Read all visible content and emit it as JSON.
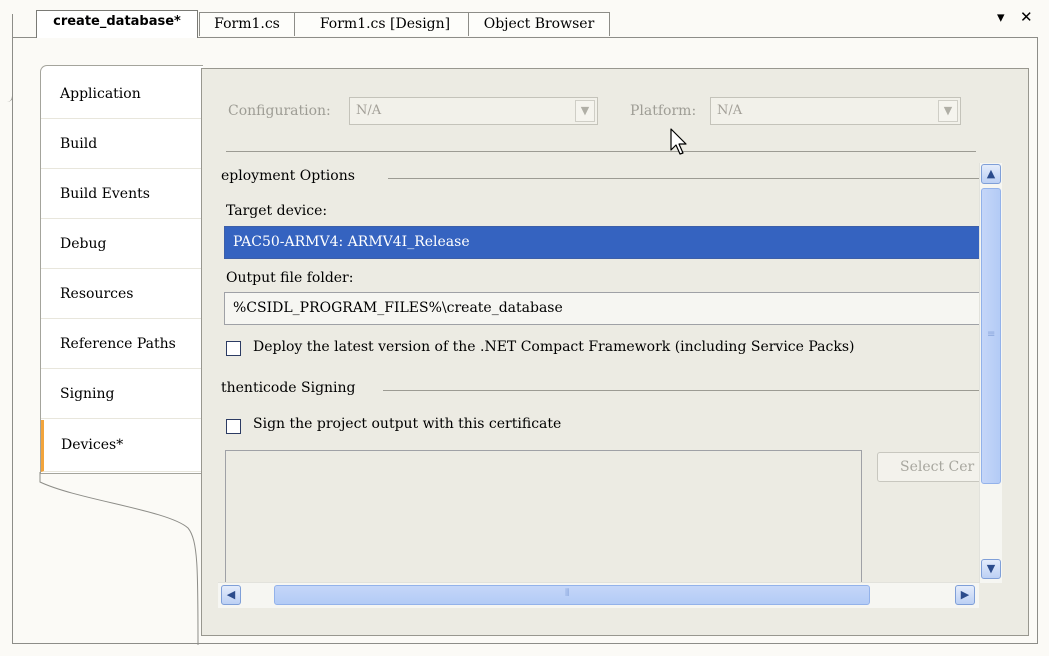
{
  "doc_tabs": [
    {
      "label": "create_database*",
      "active": true
    },
    {
      "label": "Form1.cs",
      "active": false
    },
    {
      "label": "Form1.cs [Design]",
      "active": false
    },
    {
      "label": "Object Browser",
      "active": false
    }
  ],
  "window_controls": {
    "dropdown_glyph": "▾",
    "close_glyph": "✕"
  },
  "pages": [
    {
      "label": "Application"
    },
    {
      "label": "Build"
    },
    {
      "label": "Build Events"
    },
    {
      "label": "Debug"
    },
    {
      "label": "Resources"
    },
    {
      "label": "Reference Paths"
    },
    {
      "label": "Signing"
    },
    {
      "label": "Devices*",
      "active": true
    }
  ],
  "config": {
    "configuration_label": "Configuration:",
    "configuration_value": "N/A",
    "platform_label": "Platform:",
    "platform_value": "N/A"
  },
  "deployment": {
    "section_title": "eployment Options",
    "target_device_label": "Target device:",
    "target_device_value": "PAC50-ARMV4: ARMV4I_Release",
    "output_folder_label": "Output file folder:",
    "output_folder_value": "%CSIDL_PROGRAM_FILES%\\create_database",
    "deploy_cf_label": "Deploy the latest version of the .NET Compact Framework (including Service Packs)",
    "deploy_cf_checked": false
  },
  "authenticode": {
    "section_title": "thenticode Signing",
    "sign_label": "Sign the project output with this certificate",
    "sign_checked": false,
    "select_cert_button": "Select Cer"
  },
  "icons": {
    "scroll_up": "up-arrow-icon",
    "scroll_down": "down-arrow-icon",
    "scroll_left": "left-arrow-icon",
    "scroll_right": "right-arrow-icon",
    "cursor": "mouse-pointer-icon"
  },
  "colors": {
    "selection": "#3563c0",
    "active_tab_accent": "#f2a43c",
    "scrollbar": "#b3cbf6"
  }
}
